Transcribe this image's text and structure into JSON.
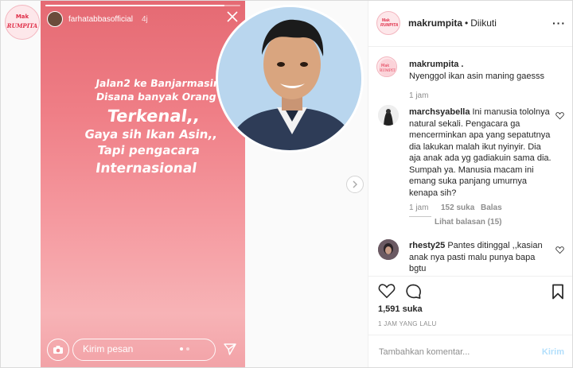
{
  "brand": {
    "logo_top": "Mak",
    "logo_bottom": "RUMPITA"
  },
  "story": {
    "username": "farhatabbasofficial",
    "time": "4j",
    "lines": {
      "l1": "Jalan2 ke Banjarmasin",
      "l2": "Disana banyak Orang",
      "l3": "Terkenal,,",
      "l4": "Gaya sih Ikan Asin,,",
      "l5": "Tapi pengacara",
      "l6": "Internasional"
    },
    "message_placeholder": "Kirim pesan",
    "progress_fraction": 0.92
  },
  "post": {
    "username": "makrumpita",
    "follow_status": "Diikuti",
    "caption_user": "makrumpita .",
    "caption_text": "Nyenggol ikan asin maning gaesss",
    "caption_time": "1 jam",
    "comments": [
      {
        "user": "marchsyabella",
        "text": "Ini manusia tololnya natural sekali. Pengacara ga mencerminkan apa yang sepatutnya dia lakukan malah ikut nyinyir. Dia aja anak ada yg gadiakuin sama dia. Sumpah ya. Manusia macam ini emang suka panjang umurnya kenapa sih?",
        "time": "1 jam",
        "likes": "152 suka",
        "reply": "Balas",
        "view_replies": "Lihat balasan (15)"
      },
      {
        "user": "rhesty25",
        "text": "Pantes ditinggal ,,kasian anak nya pasti malu punya bapa bgtu"
      }
    ],
    "likes_count": "1,591 suka",
    "time_ago": "1 JAM YANG LALU",
    "comment_placeholder": "Tambahkan komentar...",
    "post_label": "Kirim"
  }
}
